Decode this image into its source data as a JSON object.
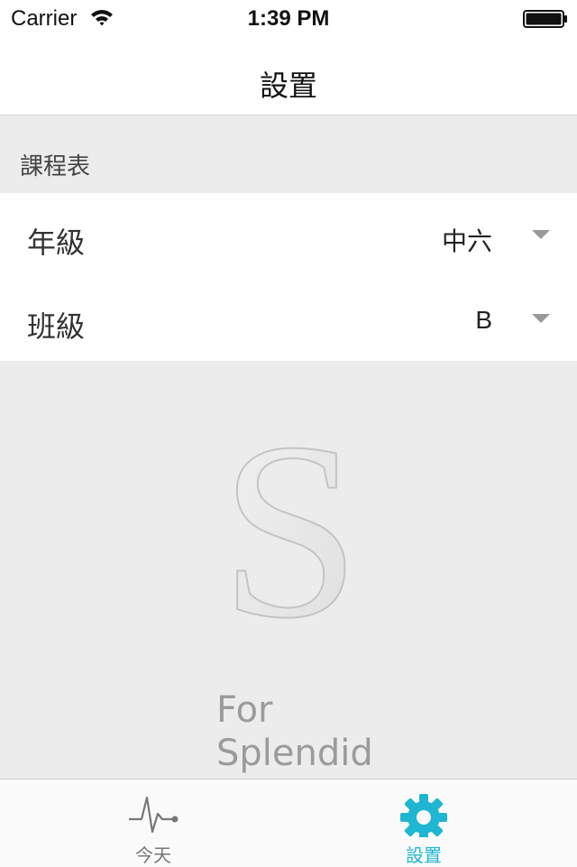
{
  "status_bar": {
    "carrier": "Carrier",
    "time": "1:39 PM"
  },
  "nav_bar": {
    "title": "設置"
  },
  "section": {
    "title": "課程表"
  },
  "rows": [
    {
      "label": "年級",
      "value": "中六"
    },
    {
      "label": "班級",
      "value": "B"
    }
  ],
  "logo": {
    "letter": "S",
    "tagline_line1": "For",
    "tagline_line2": "Splendid"
  },
  "tab_bar": {
    "tabs": [
      {
        "label": "今天",
        "icon": "heartbeat-icon",
        "active": false
      },
      {
        "label": "設置",
        "icon": "gear-icon",
        "active": true
      }
    ]
  },
  "colors": {
    "accent": "#1eb6d2",
    "background": "#ececec",
    "inactive_tab": "#777777"
  }
}
